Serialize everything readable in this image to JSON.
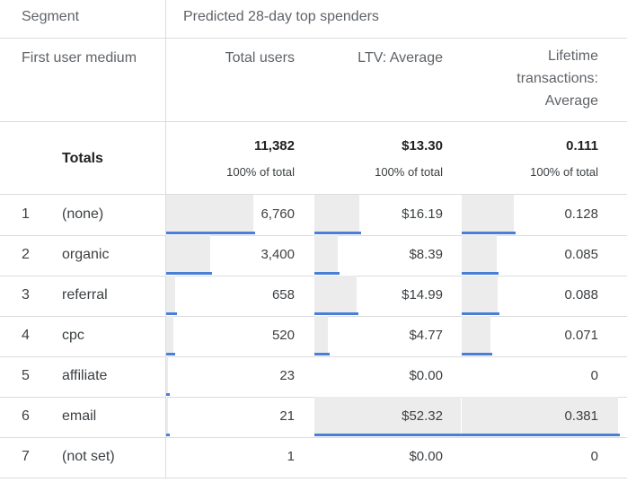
{
  "header": {
    "segment_label": "Segment",
    "segment_value": "Predicted 28-day top spenders",
    "dimension_label": "First user medium",
    "columns": {
      "total_users": "Total users",
      "ltv_average": "LTV: Average",
      "lifetime_transactions_l1": "Lifetime",
      "lifetime_transactions_l2": "transactions:",
      "lifetime_transactions_l3": "Average"
    }
  },
  "totals": {
    "label": "Totals",
    "total_users": "11,382",
    "total_users_pct": "100% of total",
    "ltv_average": "$13.30",
    "ltv_average_pct": "100% of total",
    "lifetime_transactions": "0.111",
    "lifetime_transactions_pct": "100% of total"
  },
  "rows": [
    {
      "num": "1",
      "medium": "(none)",
      "total_users": "6,760",
      "ltv_average": "$16.19",
      "lifetime_transactions": "0.128",
      "users_share": 0.594,
      "ltv_share": 0.309,
      "tx_share": 0.336
    },
    {
      "num": "2",
      "medium": "organic",
      "total_users": "3,400",
      "ltv_average": "$8.39",
      "lifetime_transactions": "0.085",
      "users_share": 0.299,
      "ltv_share": 0.16,
      "tx_share": 0.223
    },
    {
      "num": "3",
      "medium": "referral",
      "total_users": "658",
      "ltv_average": "$14.99",
      "lifetime_transactions": "0.088",
      "users_share": 0.058,
      "ltv_share": 0.287,
      "tx_share": 0.231
    },
    {
      "num": "4",
      "medium": "cpc",
      "total_users": "520",
      "ltv_average": "$4.77",
      "lifetime_transactions": "0.071",
      "users_share": 0.046,
      "ltv_share": 0.091,
      "tx_share": 0.186
    },
    {
      "num": "5",
      "medium": "affiliate",
      "total_users": "23",
      "ltv_average": "$0.00",
      "lifetime_transactions": "0",
      "users_share": 0.002,
      "ltv_share": 0.0,
      "tx_share": 0.0
    },
    {
      "num": "6",
      "medium": "email",
      "total_users": "21",
      "ltv_average": "$52.32",
      "lifetime_transactions": "0.381",
      "users_share": 0.002,
      "ltv_share": 1.0,
      "tx_share": 1.0
    },
    {
      "num": "7",
      "medium": "(not set)",
      "total_users": "1",
      "ltv_average": "$0.00",
      "lifetime_transactions": "0",
      "users_share": 0.0,
      "ltv_share": 0.0,
      "tx_share": 0.0
    }
  ],
  "colors": {
    "bar_fill": "#ececec",
    "bar_line": "#4a7fd6",
    "grid": "#dadce0"
  }
}
